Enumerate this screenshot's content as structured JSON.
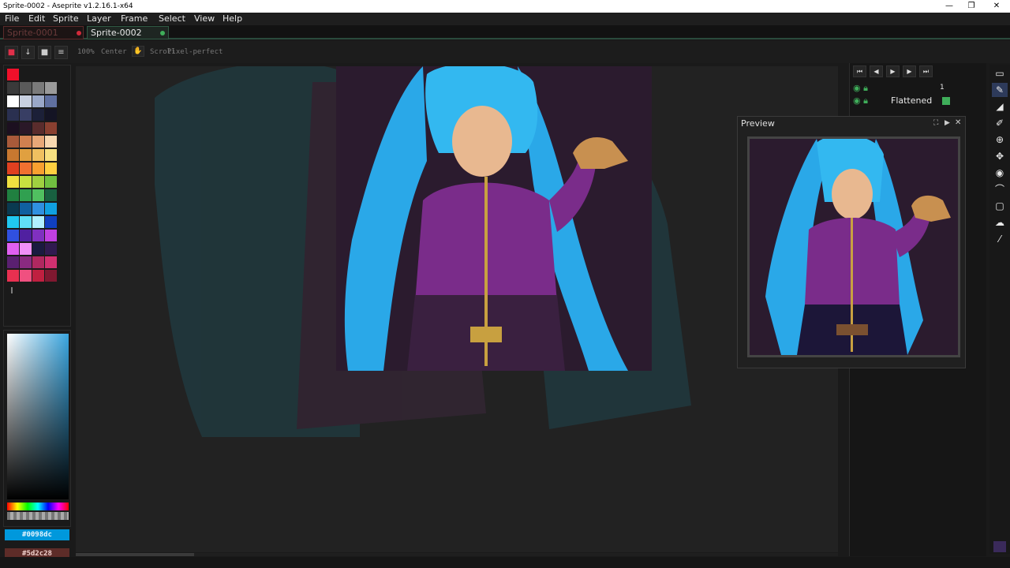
{
  "window": {
    "title": "Sprite-0002 - Aseprite v1.2.16.1-x64",
    "minimize": "—",
    "maximize": "❐",
    "close": "✕"
  },
  "menu": [
    "File",
    "Edit",
    "Sprite",
    "Layer",
    "Frame",
    "Select",
    "View",
    "Help"
  ],
  "tabs": [
    {
      "label": "Sprite-0001",
      "dot_color": "#d12a3a",
      "active": false
    },
    {
      "label": "Sprite-0002",
      "dot_color": "#3fae5a",
      "active": true
    }
  ],
  "toolbar": {
    "zoom_label": "100%",
    "center_label": "Center",
    "scroll_label": "Scroll",
    "pixel_perfect_label": "Pixel-perfect"
  },
  "palette": {
    "colors": [
      "#f0102a",
      "#1a1a1a",
      "#1a1a1a",
      "#1a1a1a",
      "#3a3a3a",
      "#5a5a5a",
      "#7a7a7a",
      "#9a9a9a",
      "#ffffff",
      "#c8d0e0",
      "#9aa8c8",
      "#6070a0",
      "#2a3050",
      "#383e64",
      "#1c2038",
      "#141424",
      "#1c1020",
      "#2a1828",
      "#5a2c2c",
      "#8a4030",
      "#a85a3a",
      "#d08050",
      "#e8a878",
      "#f8d8b0",
      "#c87830",
      "#e0a040",
      "#f0c060",
      "#f8e080",
      "#e04020",
      "#f07030",
      "#f8a030",
      "#ffd040",
      "#f0e040",
      "#c8e040",
      "#a0d040",
      "#70c040",
      "#208040",
      "#30a050",
      "#50c060",
      "#186040",
      "#0a3a50",
      "#1060a0",
      "#3090e0",
      "#10a0e0",
      "#20c8f0",
      "#60e0f8",
      "#b0f0ff",
      "#1040c0",
      "#3050e0",
      "#5020a0",
      "#8030c0",
      "#c040e0",
      "#e060f0",
      "#f090f8",
      "#1a1a40",
      "#301a50",
      "#5a2070",
      "#8a2a80",
      "#b02860",
      "#d03070",
      "#e83050",
      "#f05080",
      "#c02040",
      "#801830"
    ]
  },
  "colors": {
    "foreground_hex": "#0098dc",
    "background_hex": "#5d2c28"
  },
  "layers": [
    {
      "name": "",
      "frame": "1"
    },
    {
      "name": "Flattened",
      "frame": ""
    }
  ],
  "preview": {
    "title": "Preview"
  },
  "tools": [
    "▭",
    "✎",
    "◢",
    "✐",
    "⊕",
    "✥",
    "◉",
    "⌒",
    "▢",
    "☁",
    "⁄"
  ],
  "timeline_buttons": [
    "⏮",
    "◀",
    "▶",
    "▶",
    "⏭"
  ],
  "status": {
    "left": "",
    "right": ""
  }
}
